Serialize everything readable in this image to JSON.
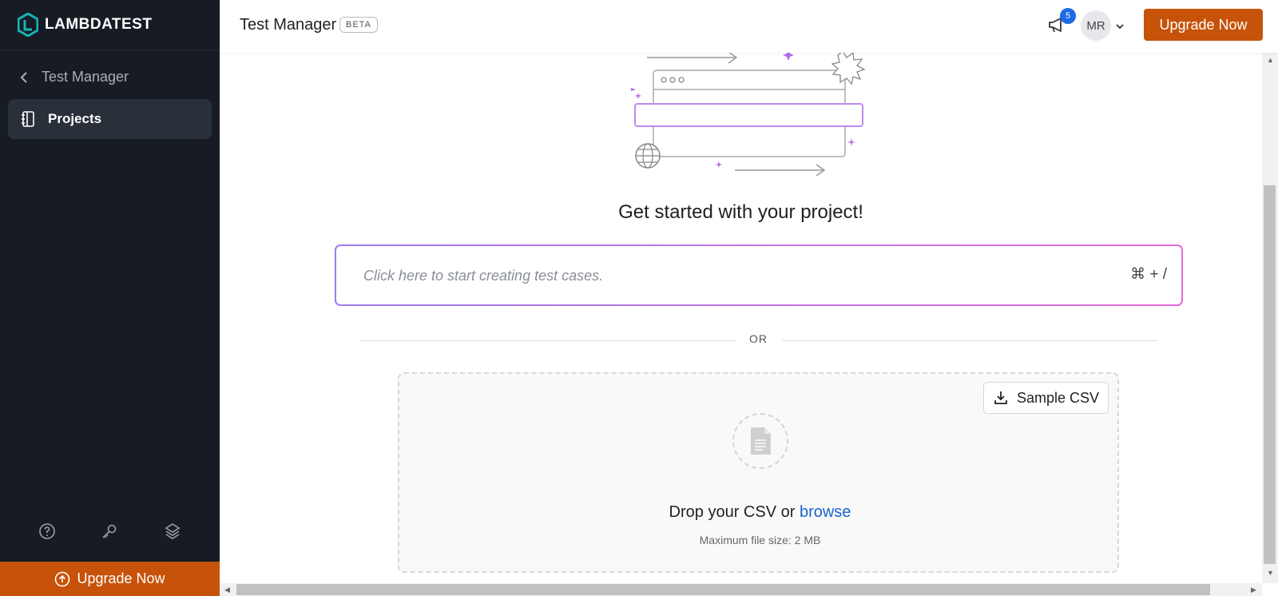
{
  "sidebar": {
    "logo_text": "LAMBDATEST",
    "back_label": "Test Manager",
    "nav": [
      {
        "label": "Projects",
        "icon": "notebook-icon"
      }
    ],
    "tools": [
      "help-icon",
      "key-icon",
      "layers-icon"
    ],
    "upgrade_label": "Upgrade Now"
  },
  "header": {
    "title": "Test Manager",
    "badge": "BETA",
    "notification_count": "5",
    "avatar_initials": "MR",
    "upgrade_label": "Upgrade Now"
  },
  "main": {
    "heading": "Get started with your project!",
    "create_placeholder": "Click here to start creating test cases.",
    "shortcut": "⌘ + /",
    "divider_text": "OR",
    "sample_csv_label": "Sample CSV",
    "drop_text": "Drop your CSV or",
    "browse_text": "browse",
    "max_size_text": "Maximum file size: 2 MB"
  },
  "colors": {
    "sidebar_bg": "#171c24",
    "accent_orange": "#c7520a",
    "link_blue": "#1a64d0",
    "gradient_start": "#9d7cf0",
    "gradient_end": "#e66ad9"
  }
}
